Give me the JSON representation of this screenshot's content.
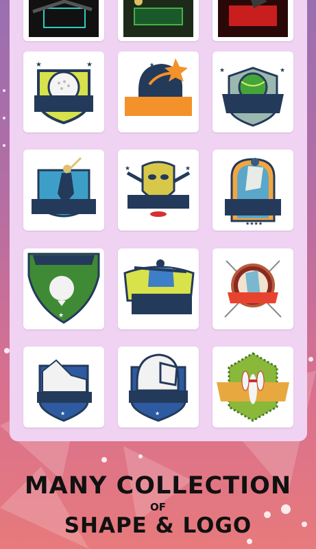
{
  "caption": {
    "line1": "MANY COLLECTION",
    "line2": "OF",
    "line3": "SHAPE & LOGO"
  },
  "logos": [
    {
      "name": "gamer-logo-1"
    },
    {
      "name": "gamer-logo-2"
    },
    {
      "name": "gamer-logo-3"
    },
    {
      "name": "golf-ball-logo"
    },
    {
      "name": "football-helmet-logo"
    },
    {
      "name": "tennis-ball-logo"
    },
    {
      "name": "baseball-batter-logo"
    },
    {
      "name": "hockey-mask-logo"
    },
    {
      "name": "baseball-pitcher-logo"
    },
    {
      "name": "golf-shield-logo"
    },
    {
      "name": "baseball-catcher-logo"
    },
    {
      "name": "golfer-logo"
    },
    {
      "name": "sneaker-logo"
    },
    {
      "name": "football-helmet-shield-logo"
    },
    {
      "name": "bowling-pins-logo"
    }
  ],
  "colors": {
    "panel": "#f0d2f2",
    "navy": "#243a5a",
    "orange": "#f3922a",
    "green": "#3f8a35"
  }
}
